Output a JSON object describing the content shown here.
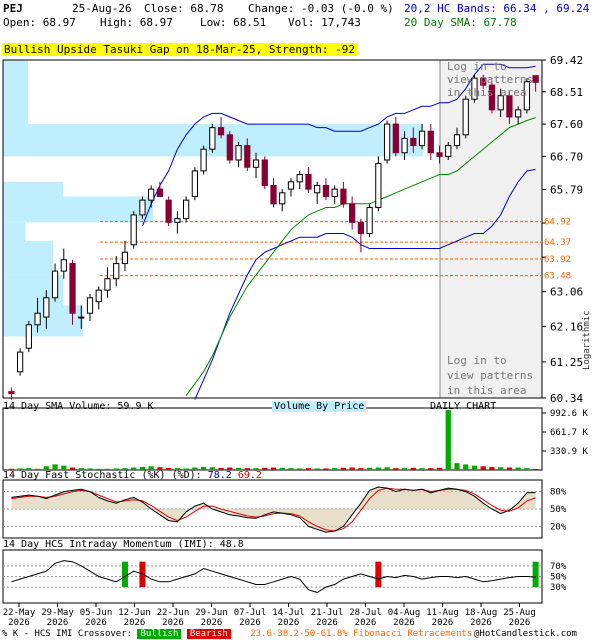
{
  "header": {
    "symbol": "PEJ",
    "date": "25-Aug-26",
    "close_label": "Close: 68.78",
    "change_label": "Change: -0.03 (-0.0 %)",
    "open_label": "Open: 68.97",
    "high_label": "High: 68.97",
    "low_label": "Low: 68.51",
    "vol_label": "Vol: 17,743",
    "bands_label": "20,2 HC Bands: 66.34 , 69.24",
    "sma_label": "20 Day SMA: 67.78"
  },
  "pattern_banner": "Bullish Upside Tasuki Gap on 18-Mar-25, Strength: -92",
  "login_text": [
    "Log in to",
    "view patterns",
    "in this area"
  ],
  "side_label": "Logarithmic",
  "volume_panel": {
    "title": "14 Day SMA Volume: 59.9 K",
    "vbp": "Volume By Price",
    "daily": "DAILY CHART"
  },
  "stoch_panel": {
    "title": "14 Day Fast Stochastic (%K)",
    "d_label": "(%D):",
    "k_value": "78.2",
    "d_value": "69.2"
  },
  "imi_panel": {
    "title": "14 Day HCS Intraday Momentum (IMI): 48.8"
  },
  "footer": {
    "legend_prefix": "% K - HCS IMI Crossover:",
    "bullish": "Bullish",
    "bearish": "Bearish",
    "fib": "23.6-38.2-50-61.8% Fibonacci Retracements",
    "copyright": "@HotCandlestick.com"
  },
  "colors": {
    "up": "#000000",
    "down": "#880033",
    "band": "#0000cc",
    "sma": "#008800",
    "vbp": "#bfefff",
    "fib": "#ff6600",
    "volume": "#dd0000",
    "volume_up": "#00aa00"
  },
  "chart_data": [
    {
      "type": "candlestick",
      "scale": "log",
      "ylim": [
        60.34,
        69.42
      ],
      "yticks": [
        69.42,
        68.51,
        67.6,
        66.7,
        65.79,
        64.88,
        63.97,
        63.06,
        62.16,
        61.25,
        60.34
      ],
      "ytick_labels": [
        "69.42",
        "68.51",
        "67.60",
        "66.70",
        "65.79",
        "",
        "",
        "63.06",
        "62.16",
        "61.25",
        "60.34"
      ],
      "fib_levels": [
        64.92,
        64.37,
        63.92,
        63.48
      ],
      "fib_labels": [
        "64.92",
        "64.37",
        "63.92",
        "63.48"
      ],
      "x_labels": [
        "22-May\n2026",
        "29-May\n2026",
        "05-Jun\n2026",
        "12-Jun\n2026",
        "22-Jun\n2026",
        "29-Jun\n2026",
        "07-Jul\n2026",
        "14-Jul\n2026",
        "21-Jul\n2026",
        "28-Jul\n2026",
        "04-Aug\n2026",
        "11-Aug\n2026",
        "18-Aug\n2026",
        "25-Aug\n2026"
      ],
      "ohlc": [
        [
          60.5,
          60.6,
          60.3,
          60.45
        ],
        [
          61.0,
          61.6,
          60.9,
          61.5
        ],
        [
          61.6,
          62.3,
          61.5,
          62.2
        ],
        [
          62.2,
          62.9,
          62.0,
          62.5
        ],
        [
          62.4,
          63.1,
          62.1,
          62.9
        ],
        [
          62.9,
          63.8,
          62.8,
          63.6
        ],
        [
          63.6,
          64.2,
          63.4,
          63.9
        ],
        [
          63.8,
          63.9,
          62.2,
          62.5
        ],
        [
          62.4,
          62.7,
          62.1,
          62.4
        ],
        [
          62.5,
          63.0,
          62.3,
          62.9
        ],
        [
          62.8,
          63.2,
          62.6,
          63.1
        ],
        [
          63.1,
          63.7,
          62.9,
          63.4
        ],
        [
          63.4,
          64.0,
          63.2,
          63.8
        ],
        [
          63.8,
          64.4,
          63.6,
          64.1
        ],
        [
          64.3,
          65.2,
          64.2,
          65.1
        ],
        [
          65.1,
          65.6,
          65.0,
          65.5
        ],
        [
          65.5,
          65.9,
          65.3,
          65.8
        ],
        [
          65.8,
          66.0,
          65.6,
          65.6
        ],
        [
          65.5,
          65.6,
          64.8,
          64.9
        ],
        [
          64.9,
          65.2,
          64.6,
          65.0
        ],
        [
          65.0,
          65.6,
          64.9,
          65.5
        ],
        [
          65.6,
          66.4,
          65.5,
          66.3
        ],
        [
          66.3,
          67.0,
          66.2,
          66.9
        ],
        [
          66.9,
          67.6,
          66.8,
          67.5
        ],
        [
          67.5,
          67.8,
          67.2,
          67.3
        ],
        [
          67.3,
          67.4,
          66.5,
          66.6
        ],
        [
          66.6,
          67.1,
          66.4,
          67.0
        ],
        [
          67.0,
          67.2,
          66.3,
          66.4
        ],
        [
          66.4,
          66.8,
          66.1,
          66.6
        ],
        [
          66.6,
          66.7,
          65.8,
          65.9
        ],
        [
          65.9,
          66.1,
          65.3,
          65.4
        ],
        [
          65.4,
          65.8,
          65.2,
          65.7
        ],
        [
          65.8,
          66.1,
          65.6,
          66.0
        ],
        [
          66.0,
          66.3,
          65.8,
          66.2
        ],
        [
          66.2,
          66.4,
          65.7,
          65.8
        ],
        [
          65.7,
          66.0,
          65.4,
          65.9
        ],
        [
          65.9,
          66.1,
          65.5,
          65.6
        ],
        [
          65.6,
          65.9,
          65.4,
          65.8
        ],
        [
          65.8,
          66.0,
          65.3,
          65.4
        ],
        [
          65.4,
          65.6,
          64.7,
          64.9
        ],
        [
          64.9,
          65.0,
          64.1,
          64.6
        ],
        [
          64.6,
          65.4,
          64.5,
          65.3
        ],
        [
          65.3,
          66.7,
          65.2,
          66.5
        ],
        [
          66.6,
          67.7,
          66.5,
          67.6
        ],
        [
          67.6,
          67.8,
          66.7,
          66.8
        ],
        [
          66.8,
          67.4,
          66.6,
          67.2
        ],
        [
          67.2,
          67.5,
          66.8,
          67.0
        ],
        [
          67.0,
          67.6,
          66.9,
          67.4
        ],
        [
          67.4,
          67.6,
          66.6,
          66.8
        ],
        [
          66.8,
          67.0,
          66.5,
          66.7
        ],
        [
          66.7,
          67.1,
          66.6,
          67.0
        ],
        [
          67.0,
          67.5,
          66.9,
          67.3
        ],
        [
          67.3,
          68.4,
          67.2,
          68.3
        ],
        [
          68.3,
          69.0,
          68.2,
          68.9
        ],
        [
          68.9,
          69.0,
          68.6,
          68.7
        ],
        [
          68.7,
          68.8,
          67.9,
          68.0
        ],
        [
          68.0,
          68.6,
          67.8,
          68.4
        ],
        [
          68.4,
          68.5,
          67.6,
          67.8
        ],
        [
          67.8,
          68.1,
          67.6,
          68.0
        ],
        [
          68.0,
          68.9,
          67.9,
          68.8
        ],
        [
          68.97,
          68.97,
          68.51,
          68.78
        ]
      ],
      "upper_band": [
        null,
        null,
        null,
        null,
        null,
        null,
        null,
        null,
        null,
        null,
        null,
        null,
        null,
        null,
        null,
        64.8,
        65.4,
        65.9,
        66.3,
        66.9,
        67.3,
        67.6,
        67.8,
        67.9,
        67.9,
        67.8,
        67.7,
        67.6,
        67.6,
        67.6,
        67.6,
        67.6,
        67.6,
        67.6,
        67.6,
        67.5,
        67.5,
        67.4,
        67.4,
        67.4,
        67.4,
        67.5,
        67.6,
        67.8,
        67.9,
        67.9,
        68.0,
        68.1,
        68.1,
        68.2,
        68.2,
        68.3,
        68.6,
        69.0,
        69.3,
        69.3,
        69.3,
        69.2,
        69.2,
        69.2,
        69.24
      ],
      "lower_band": [
        null,
        null,
        null,
        null,
        null,
        null,
        null,
        null,
        null,
        null,
        null,
        null,
        null,
        null,
        null,
        null,
        null,
        null,
        null,
        null,
        null,
        60.3,
        60.8,
        61.3,
        61.9,
        62.5,
        63.0,
        63.5,
        63.9,
        64.1,
        64.2,
        64.3,
        64.4,
        64.5,
        64.5,
        64.5,
        64.6,
        64.6,
        64.6,
        64.5,
        64.3,
        64.2,
        64.2,
        64.2,
        64.2,
        64.2,
        64.2,
        64.2,
        64.2,
        64.2,
        64.3,
        64.4,
        64.5,
        64.6,
        64.6,
        64.8,
        65.1,
        65.6,
        66.0,
        66.3,
        66.34
      ],
      "sma20": [
        null,
        null,
        null,
        null,
        null,
        null,
        null,
        null,
        null,
        null,
        null,
        null,
        null,
        null,
        null,
        null,
        null,
        null,
        null,
        null,
        60.4,
        60.7,
        61.0,
        61.4,
        61.9,
        62.4,
        62.8,
        63.2,
        63.5,
        63.8,
        64.1,
        64.4,
        64.7,
        64.9,
        65.1,
        65.2,
        65.3,
        65.3,
        65.4,
        65.4,
        65.4,
        65.4,
        65.5,
        65.6,
        65.7,
        65.8,
        65.9,
        66.0,
        66.1,
        66.2,
        66.2,
        66.3,
        66.5,
        66.7,
        66.9,
        67.1,
        67.3,
        67.5,
        67.6,
        67.7,
        67.78
      ]
    },
    {
      "type": "bar",
      "name": "volume",
      "yticks": [
        "992.6 K",
        "661.7 K",
        "330.9 K"
      ],
      "values": [
        20,
        25,
        30,
        20,
        60,
        90,
        70,
        40,
        30,
        25,
        20,
        20,
        25,
        30,
        40,
        50,
        60,
        45,
        35,
        30,
        25,
        40,
        50,
        45,
        35,
        40,
        35,
        30,
        30,
        35,
        40,
        35,
        30,
        25,
        30,
        25,
        25,
        30,
        35,
        40,
        30,
        35,
        40,
        45,
        30,
        30,
        35,
        30,
        30,
        35,
        970,
        110,
        90,
        70,
        60,
        50,
        45,
        40,
        40,
        30,
        18
      ]
    },
    {
      "type": "line",
      "name": "stochastic",
      "yticks": [
        "80%",
        "50%",
        "20%"
      ],
      "k": [
        70,
        72,
        74,
        72,
        68,
        74,
        80,
        82,
        84,
        80,
        70,
        64,
        60,
        66,
        70,
        62,
        50,
        40,
        30,
        28,
        45,
        55,
        60,
        50,
        45,
        40,
        38,
        35,
        34,
        40,
        45,
        43,
        40,
        35,
        20,
        15,
        10,
        12,
        20,
        40,
        60,
        82,
        88,
        86,
        80,
        84,
        82,
        84,
        78,
        82,
        86,
        84,
        80,
        72,
        60,
        50,
        42,
        48,
        60,
        78,
        78.2
      ],
      "d": [
        68,
        70,
        72,
        72,
        70,
        72,
        76,
        80,
        82,
        80,
        74,
        68,
        62,
        64,
        66,
        64,
        56,
        46,
        36,
        30,
        36,
        46,
        55,
        55,
        50,
        46,
        42,
        38,
        36,
        38,
        42,
        43,
        42,
        38,
        28,
        20,
        14,
        12,
        16,
        28,
        48,
        68,
        82,
        86,
        84,
        84,
        82,
        84,
        80,
        82,
        84,
        84,
        82,
        76,
        66,
        56,
        48,
        46,
        52,
        64,
        69.2
      ]
    },
    {
      "type": "line",
      "name": "imi",
      "yticks": [
        "70%",
        "50%",
        "30%"
      ],
      "values": [
        40,
        45,
        50,
        55,
        60,
        75,
        80,
        78,
        70,
        60,
        50,
        45,
        40,
        50,
        60,
        55,
        45,
        40,
        40,
        45,
        50,
        55,
        65,
        60,
        55,
        50,
        45,
        40,
        35,
        35,
        40,
        45,
        50,
        45,
        25,
        20,
        30,
        35,
        45,
        50,
        55,
        50,
        45,
        50,
        48,
        52,
        50,
        45,
        48,
        50,
        50,
        48,
        50,
        45,
        40,
        42,
        45,
        48,
        50,
        50,
        48.8
      ]
    }
  ]
}
